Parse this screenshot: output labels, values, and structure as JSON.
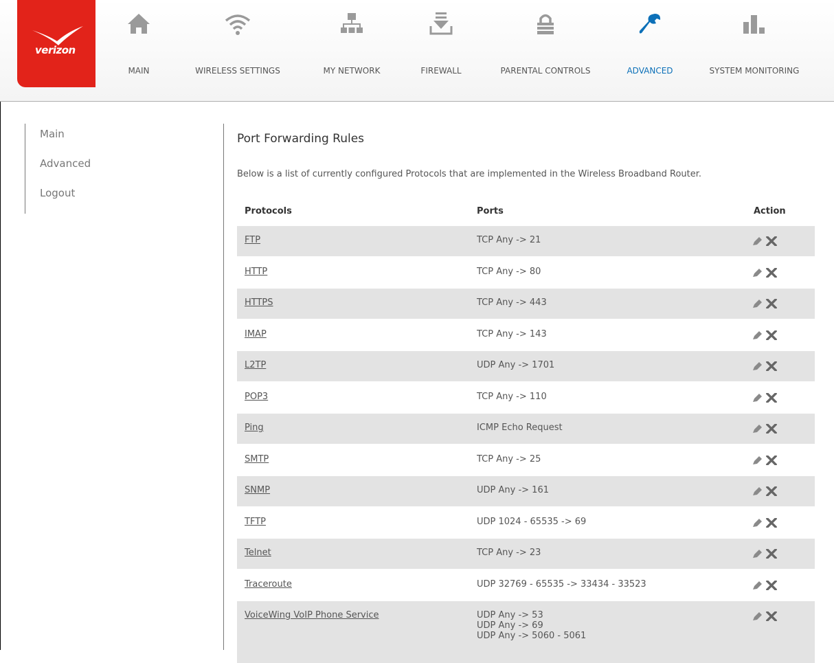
{
  "brand": {
    "logo_text": "verizon"
  },
  "nav": [
    {
      "label": "MAIN",
      "icon": "home-icon"
    },
    {
      "label": "WIRELESS SETTINGS",
      "icon": "wifi-icon"
    },
    {
      "label": "MY NETWORK",
      "icon": "network-icon"
    },
    {
      "label": "FIREWALL",
      "icon": "firewall-icon"
    },
    {
      "label": "PARENTAL CONTROLS",
      "icon": "lock-icon"
    },
    {
      "label": "ADVANCED",
      "icon": "wrench-icon",
      "active": true
    },
    {
      "label": "SYSTEM MONITORING",
      "icon": "bar-chart-icon"
    }
  ],
  "sidebar": {
    "items": [
      {
        "label": "Main"
      },
      {
        "label": "Advanced"
      },
      {
        "label": "Logout"
      }
    ]
  },
  "content": {
    "title": "Port Forwarding Rules",
    "description": "Below is a list of currently configured Protocols that are implemented in the Wireless Broadband Router.",
    "columns": {
      "protocols": "Protocols",
      "ports": "Ports",
      "action": "Action"
    },
    "rows": [
      {
        "protocol": "FTP",
        "ports": [
          "TCP Any -> 21"
        ]
      },
      {
        "protocol": "HTTP",
        "ports": [
          "TCP Any -> 80"
        ]
      },
      {
        "protocol": "HTTPS",
        "ports": [
          "TCP Any -> 443"
        ]
      },
      {
        "protocol": "IMAP",
        "ports": [
          "TCP Any -> 143"
        ]
      },
      {
        "protocol": "L2TP",
        "ports": [
          "UDP Any -> 1701"
        ]
      },
      {
        "protocol": "POP3",
        "ports": [
          "TCP Any -> 110"
        ]
      },
      {
        "protocol": "Ping",
        "ports": [
          "ICMP Echo Request"
        ]
      },
      {
        "protocol": "SMTP",
        "ports": [
          "TCP Any -> 25"
        ]
      },
      {
        "protocol": "SNMP",
        "ports": [
          "UDP Any -> 161"
        ]
      },
      {
        "protocol": "TFTP",
        "ports": [
          "UDP 1024 - 65535 -> 69"
        ]
      },
      {
        "protocol": "Telnet",
        "ports": [
          "TCP Any -> 23"
        ]
      },
      {
        "protocol": "Traceroute",
        "ports": [
          "UDP 32769 - 65535 -> 33434 - 33523"
        ]
      },
      {
        "protocol": "VoiceWing VoIP Phone Service",
        "ports": [
          "UDP Any -> 53",
          "UDP Any -> 69",
          "UDP Any -> 5060 - 5061"
        ]
      }
    ]
  },
  "colors": {
    "brand_red": "#e2231a",
    "active_blue": "#0c70b8",
    "row_shade": "#e3e3e3"
  }
}
